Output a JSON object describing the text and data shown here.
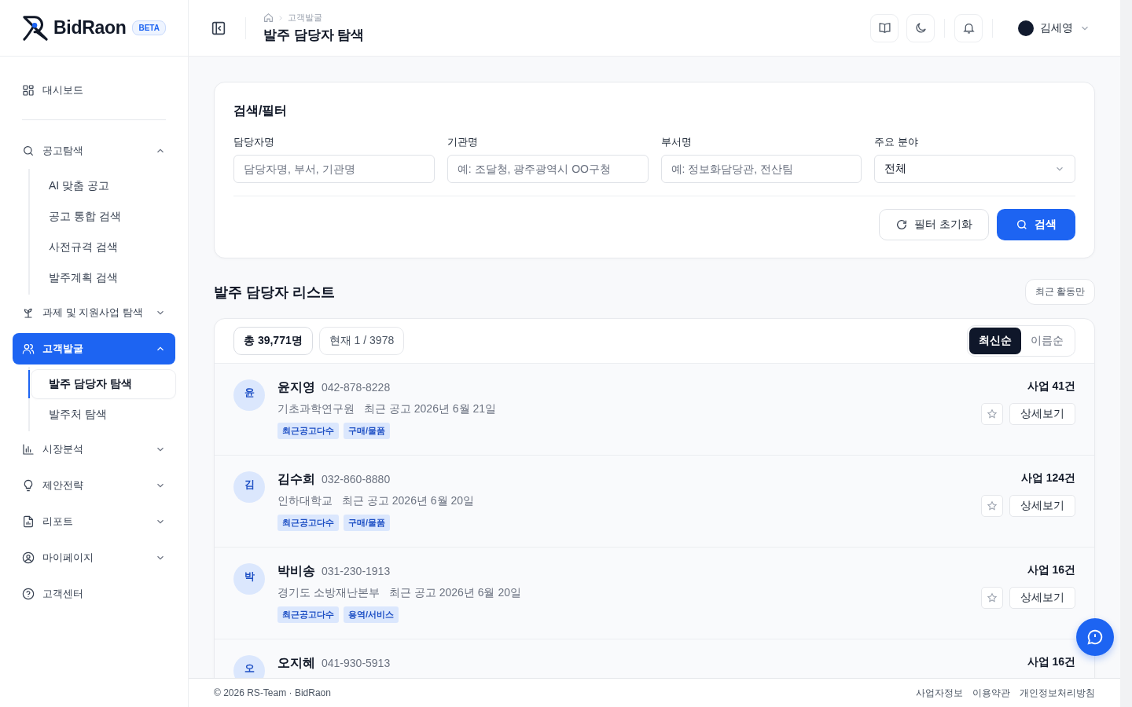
{
  "brand": {
    "name": "BidRaon",
    "badge": "BETA"
  },
  "sidebar": {
    "items": [
      {
        "label": "대시보드",
        "kind": "grid",
        "selected": false
      },
      {
        "label": "공고탐색",
        "kind": "search",
        "expanded": true,
        "selected": false,
        "children": [
          {
            "label": "AI 맞춤 공고",
            "selected": false
          },
          {
            "label": "공고 통합 검색",
            "selected": false
          },
          {
            "label": "사전규격 검색",
            "selected": false
          },
          {
            "label": "발주계획 검색",
            "selected": false
          }
        ]
      },
      {
        "label": "과제 및 지원사업 탐색",
        "kind": "sprout",
        "expanded": false,
        "selected": false
      },
      {
        "label": "고객발굴",
        "kind": "users",
        "expanded": true,
        "selected": true,
        "children": [
          {
            "label": "발주 담당자 탐색",
            "selected": true
          },
          {
            "label": "발주처 탐색",
            "selected": false
          }
        ]
      },
      {
        "label": "시장분석",
        "kind": "chart",
        "expanded": false,
        "selected": false
      },
      {
        "label": "제안전략",
        "kind": "bulb",
        "expanded": false,
        "selected": false
      },
      {
        "label": "리포트",
        "kind": "file",
        "expanded": false,
        "selected": false
      },
      {
        "label": "마이페이지",
        "kind": "user",
        "expanded": false,
        "selected": false
      },
      {
        "label": "고객센터",
        "kind": "help",
        "selected": false
      }
    ]
  },
  "header": {
    "breadcrumb": "고객발굴",
    "title": "발주 담당자 탐색",
    "user": "김세영"
  },
  "filter": {
    "title": "검색/필터",
    "fields": [
      {
        "kind": "text",
        "label": "담당자명",
        "placeholder": "담당자명, 부서, 기관명"
      },
      {
        "kind": "text",
        "label": "기관명",
        "placeholder": "예: 조달청, 광주광역시 OO구청"
      },
      {
        "kind": "text",
        "label": "부서명",
        "placeholder": "예: 정보화담당관, 전산팀"
      },
      {
        "kind": "select",
        "label": "주요 분야",
        "value": "전체"
      }
    ],
    "reset": "필터 초기화",
    "search": "검색"
  },
  "list": {
    "title": "발주 담당자 리스트",
    "recent_filter": "최근 활동만",
    "total": "총 39,771명",
    "page": "현재 1 / 3978",
    "sorts": [
      {
        "label": "최신순",
        "selected": true
      },
      {
        "label": "이름순",
        "selected": false
      }
    ],
    "rows": [
      {
        "initial": "윤",
        "name": "윤지영",
        "phone": "042-878-8228",
        "org": "기초과학연구원",
        "recent": "최근 공고 2026년 6월 21일",
        "tags": [
          "최근공고다수",
          "구매/물품"
        ],
        "count": "사업 41건",
        "starred": false,
        "detail": "상세보기"
      },
      {
        "initial": "김",
        "name": "김수희",
        "phone": "032-860-8880",
        "org": "인하대학교",
        "recent": "최근 공고 2026년 6월 20일",
        "tags": [
          "최근공고다수",
          "구매/물품"
        ],
        "count": "사업 124건",
        "starred": false,
        "detail": "상세보기"
      },
      {
        "initial": "박",
        "name": "박비송",
        "phone": "031-230-1913",
        "org": "경기도 소방재난본부",
        "recent": "최근 공고 2026년 6월 20일",
        "tags": [
          "최근공고다수",
          "용역/서비스"
        ],
        "count": "사업 16건",
        "starred": false,
        "detail": "상세보기"
      },
      {
        "initial": "오",
        "name": "오지혜",
        "phone": "041-930-5913",
        "count": "사업 16건"
      }
    ]
  },
  "footer": {
    "copyright": "© 2026 RS-Team · BidRaon",
    "links": [
      "사업자정보",
      "이용약관",
      "개인정보처리방침"
    ]
  }
}
